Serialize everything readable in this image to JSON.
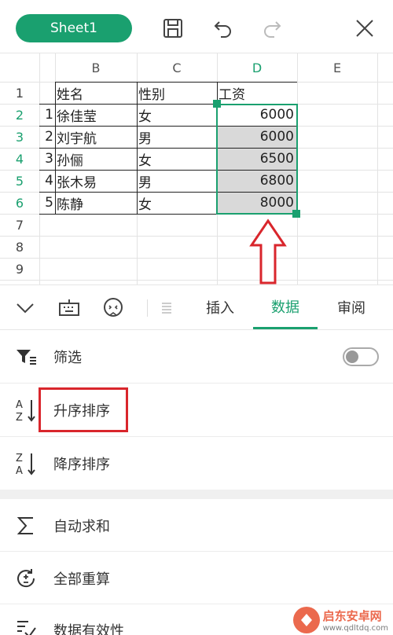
{
  "header": {
    "sheet_tab": "Sheet1",
    "icons": [
      "save-icon",
      "undo-icon",
      "redo-icon",
      "close-icon"
    ]
  },
  "grid": {
    "columns": [
      "B",
      "C",
      "D",
      "E"
    ],
    "active_column": "D",
    "row_numbers": [
      "1",
      "2",
      "3",
      "4",
      "5",
      "6",
      "7",
      "8",
      "9"
    ],
    "active_rows": [
      "2",
      "3",
      "4",
      "5",
      "6"
    ],
    "rows": [
      {
        "index": "",
        "name": "姓名",
        "gender": "性别",
        "salary": "工资"
      },
      {
        "index": "1",
        "name": "徐佳莹",
        "gender": "女",
        "salary": "6000"
      },
      {
        "index": "2",
        "name": "刘宇航",
        "gender": "男",
        "salary": "6000"
      },
      {
        "index": "3",
        "name": "孙俪",
        "gender": "女",
        "salary": "6500"
      },
      {
        "index": "4",
        "name": "张木易",
        "gender": "男",
        "salary": "6800"
      },
      {
        "index": "5",
        "name": "陈静",
        "gender": "女",
        "salary": "8000"
      }
    ],
    "selection_color": "#d9d9d9",
    "accent": "#1aa06f"
  },
  "toolbar": {
    "icons": [
      "collapse-chevron-icon",
      "keyboard-icon",
      "face-icon",
      "format-icon"
    ],
    "tabs": [
      {
        "label": "插入",
        "active": false
      },
      {
        "label": "数据",
        "active": true
      },
      {
        "label": "审阅",
        "active": false
      }
    ]
  },
  "menu": {
    "filter": "筛选",
    "filter_toggle": "off",
    "sort_asc": "升序排序",
    "sort_desc": "降序排序",
    "autosum": "自动求和",
    "recalc": "全部重算",
    "validation": "数据有效性"
  },
  "annotation": {
    "arrow_color": "#d9262c",
    "highlight_color": "#d9262c"
  },
  "watermark": {
    "title": "启东安卓网",
    "url": "www.qdltdq.com"
  }
}
